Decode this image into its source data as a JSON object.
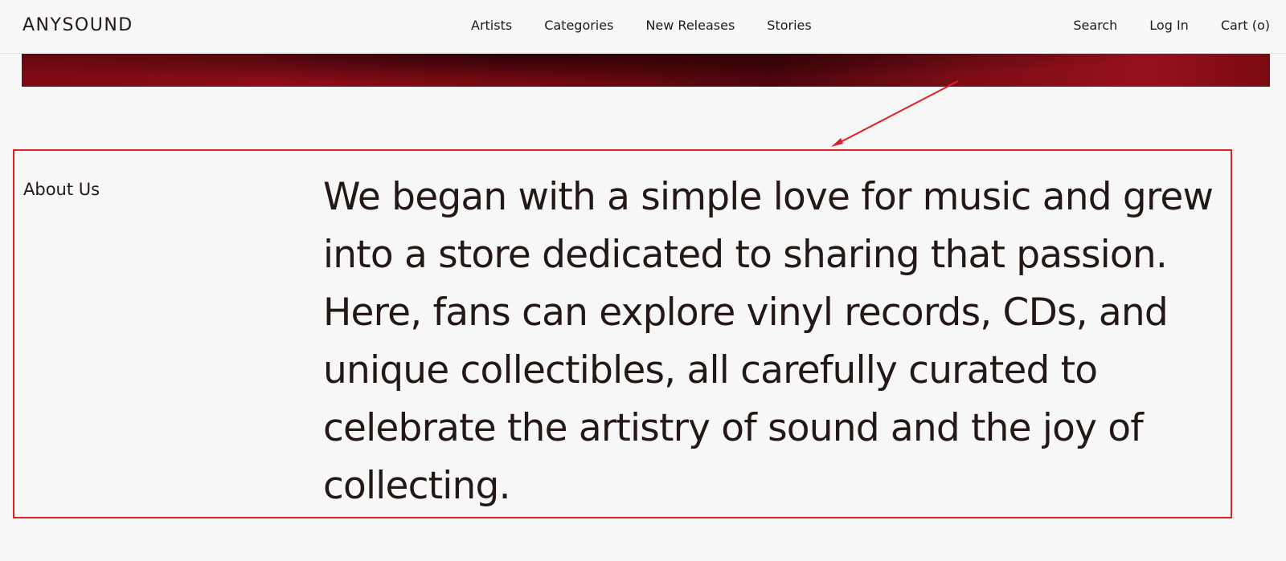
{
  "header": {
    "logo": "ANYSOUND",
    "nav": [
      {
        "label": "Artists"
      },
      {
        "label": "Categories"
      },
      {
        "label": "New Releases"
      },
      {
        "label": "Stories"
      }
    ],
    "utility": [
      {
        "label": "Search"
      },
      {
        "label": "Log In"
      },
      {
        "label": "Cart (o)"
      }
    ]
  },
  "about": {
    "label": "About Us",
    "text": "We began with a simple love for music and grew into a store dedicated to sharing that passion. Here, fans can explore vinyl records, CDs, and unique collectibles, all carefully curated to celebrate the artistry of sound and the joy of collecting."
  },
  "colors": {
    "background": "#f7f7f7",
    "text": "#231815",
    "hero": "#7a0b14",
    "annotation": "#e02027"
  }
}
